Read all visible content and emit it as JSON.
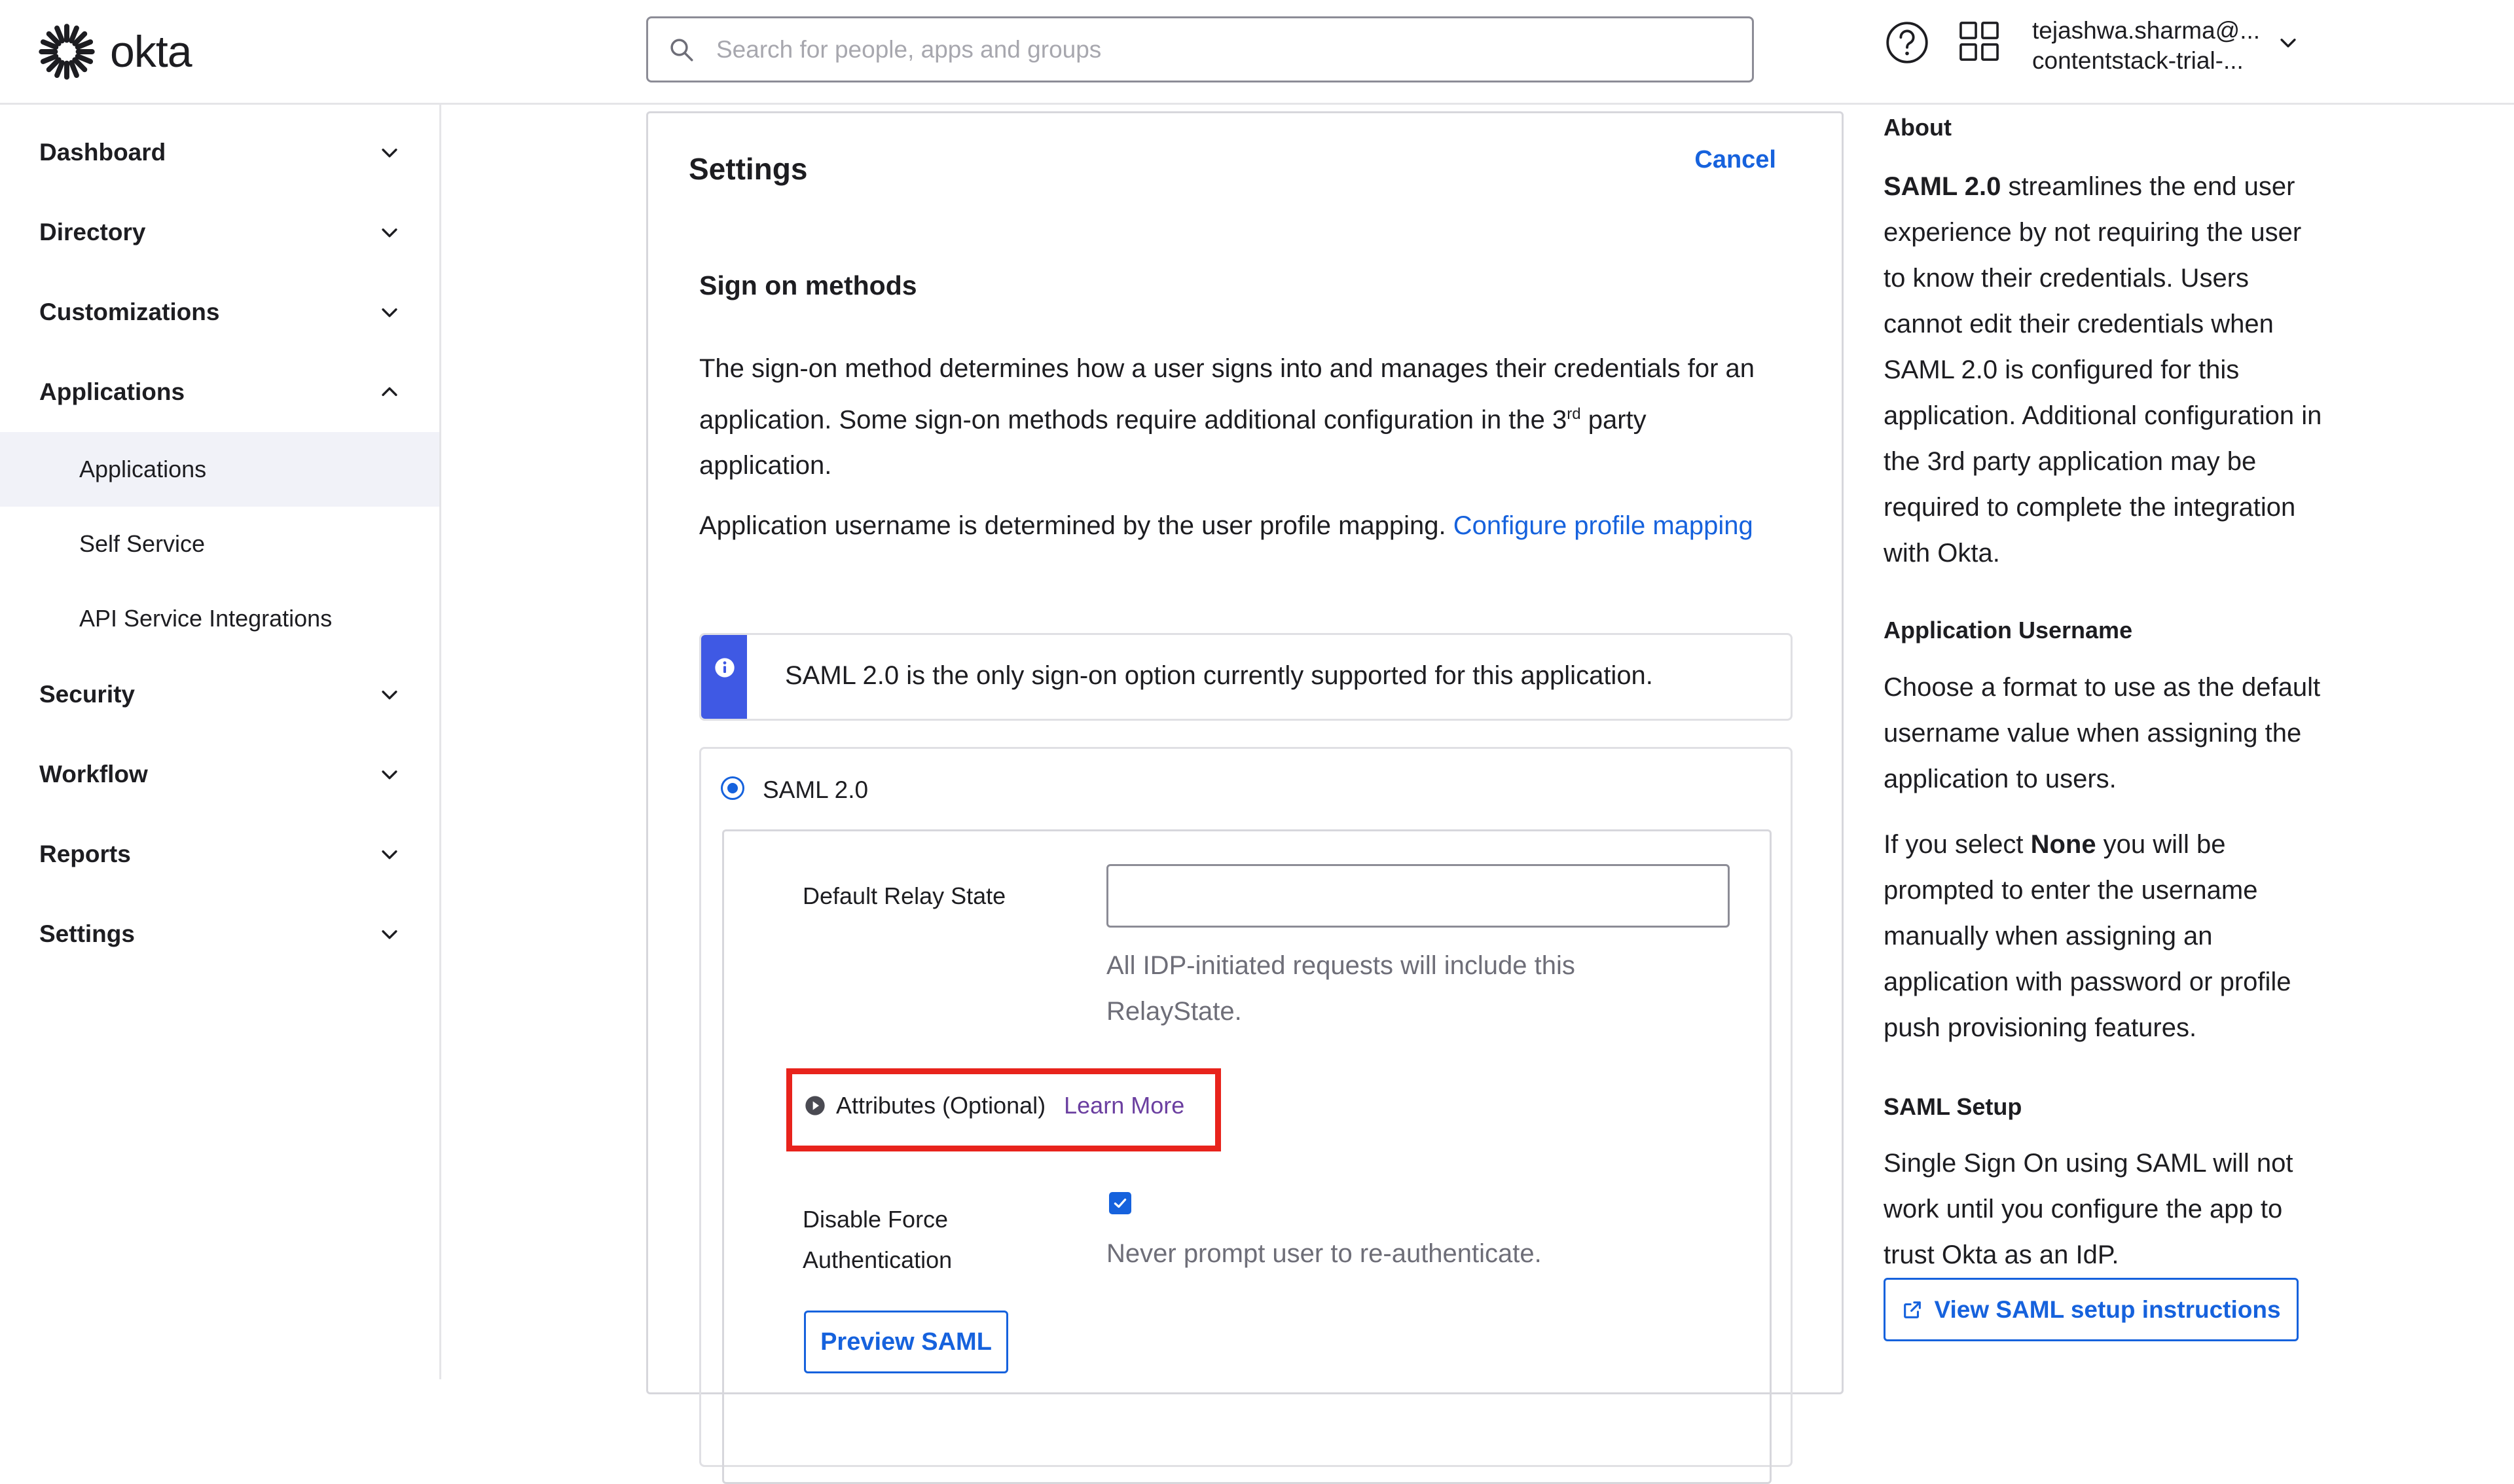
{
  "header": {
    "logo_text": "okta",
    "search_placeholder": "Search for people, apps and groups",
    "user_line1": "tejashwa.sharma@...",
    "user_line2": "contentstack-trial-..."
  },
  "sidebar": {
    "items": [
      {
        "label": "Dashboard"
      },
      {
        "label": "Directory"
      },
      {
        "label": "Customizations"
      },
      {
        "label": "Applications"
      },
      {
        "label": "Security"
      },
      {
        "label": "Workflow"
      },
      {
        "label": "Reports"
      },
      {
        "label": "Settings"
      }
    ],
    "sub_items": [
      {
        "label": "Applications"
      },
      {
        "label": "Self Service"
      },
      {
        "label": "API Service Integrations"
      }
    ]
  },
  "settings": {
    "title": "Settings",
    "cancel": "Cancel",
    "section_title": "Sign on methods",
    "description_part1": "The sign-on method determines how a user signs into and manages their credentials for an application. Some sign-on methods require additional configuration in the 3",
    "description_sup": "rd",
    "description_part2": " party application.",
    "username_text": "Application username is determined by the user profile mapping.",
    "username_link": "Configure profile mapping",
    "callout": "SAML 2.0 is the only sign-on option currently supported for this application.",
    "option_label": "SAML 2.0",
    "relay_state_label": "Default Relay State",
    "relay_state_value": "",
    "relay_state_hint": "All IDP-initiated requests will include this RelayState.",
    "attributes_label": "Attributes (Optional)",
    "learn_more": "Learn More",
    "disable_force_auth_label": "Disable Force Authentication",
    "disable_force_auth_checked": true,
    "disable_force_auth_hint": "Never prompt user to re-authenticate.",
    "preview_button": "Preview SAML"
  },
  "about": {
    "heading": "About",
    "para1_bold": "SAML 2.0",
    "para1_rest": " streamlines the end user experience by not requiring the user to know their credentials. Users cannot edit their credentials when SAML 2.0 is configured for this application. Additional configuration in the 3rd party application may be required to complete the integration with Okta.",
    "username_heading": "Application Username",
    "username_para": "Choose a format to use as the default username value when assigning the application to users.",
    "none_pre": "If you select ",
    "none_bold": "None",
    "none_post": " you will be prompted to enter the username manually when assigning an application with password or profile push provisioning features.",
    "setup_heading": "SAML Setup",
    "setup_para": "Single Sign On using SAML will not work until you configure the app to trust Okta as an IdP.",
    "setup_button": "View SAML setup instructions"
  },
  "colors": {
    "accent": "#1662dd",
    "callout_bar": "#3f59e4",
    "highlight": "#e8231c",
    "learn_more": "#6b3fa0"
  }
}
